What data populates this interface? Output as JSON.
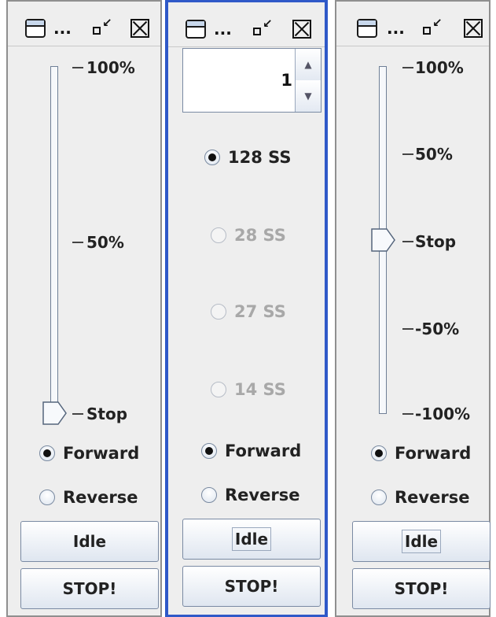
{
  "windows": [
    {
      "title": "...",
      "slider": {
        "ticks": [
          "100%",
          "50%",
          "Stop"
        ],
        "value_percent": 0
      },
      "direction": {
        "forward": "Forward",
        "reverse": "Reverse",
        "selected": "Forward"
      },
      "buttons": {
        "idle": "Idle",
        "stop": "STOP!"
      }
    },
    {
      "title": "...",
      "address": {
        "value": "1"
      },
      "speed_steps": [
        {
          "label": "128 SS",
          "selected": true,
          "enabled": true
        },
        {
          "label": "28 SS",
          "selected": false,
          "enabled": false
        },
        {
          "label": "27 SS",
          "selected": false,
          "enabled": false
        },
        {
          "label": "14 SS",
          "selected": false,
          "enabled": false
        }
      ],
      "direction": {
        "forward": "Forward",
        "reverse": "Reverse",
        "selected": "Forward"
      },
      "buttons": {
        "idle": "Idle",
        "stop": "STOP!"
      }
    },
    {
      "title": "...",
      "slider": {
        "ticks": [
          "100%",
          "50%",
          "Stop",
          "-50%",
          "-100%"
        ],
        "value_percent": 0
      },
      "direction": {
        "forward": "Forward",
        "reverse": "Reverse",
        "selected": "Forward"
      },
      "buttons": {
        "idle": "Idle",
        "stop": "STOP!"
      }
    }
  ],
  "colors": {
    "active_border": "#2f59c8",
    "panel_bg": "#eeeeee"
  }
}
